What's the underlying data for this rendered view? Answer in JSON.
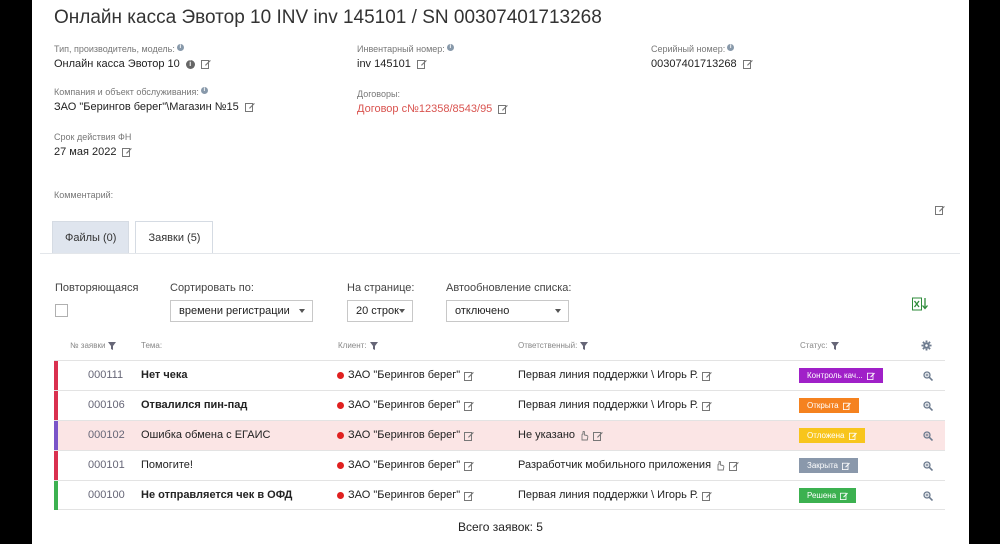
{
  "page": {
    "title": "Онлайн касса Эвотор 10 INV inv 145101 / SN 00307401713268"
  },
  "fields": {
    "type_label": "Тип, производитель, модель:",
    "type_value": "Онлайн касса Эвотор 10",
    "inventory_label": "Инвентарный номер:",
    "inventory_value": "inv 145101",
    "serial_label": "Серийный номер:",
    "serial_value": "00307401713268",
    "company_label": "Компания и объект обслуживания:",
    "company_value": "ЗАО \"Берингов берег\"\\Магазин №15",
    "contracts_label": "Договоры:",
    "contracts_value": "Договор с№12358/8543/95",
    "fn_label": "Срок действия ФН",
    "fn_value": "27 мая 2022",
    "comment_label": "Комментарий:"
  },
  "tabs": [
    {
      "label": "Файлы (0)"
    },
    {
      "label": "Заявки (5)"
    }
  ],
  "controls": {
    "recurring_label": "Повторяющаяся",
    "sort_label": "Сортировать по:",
    "sort_value": "времени регистрации",
    "per_page_label": "На странице:",
    "per_page_value": "20 строк",
    "autoupdate_label": "Автообновление списка:",
    "autoupdate_value": "отключено"
  },
  "table": {
    "headers": {
      "num": "№ заявки",
      "theme": "Тема:",
      "client": "Клиент:",
      "responsible": "Ответственный:",
      "status": "Статус:"
    },
    "rows": [
      {
        "num": "000111",
        "theme": "Нет чека",
        "client": "ЗАО \"Берингов берег\"",
        "responsible": "Первая линия поддержки \\ Игорь Р.",
        "status": "Контроль кач...",
        "status_color": "#a020c8",
        "bar_color": "#d9304f"
      },
      {
        "num": "000106",
        "theme": "Отвалился пин-пад",
        "client": "ЗАО \"Берингов берег\"",
        "responsible": "Первая линия поддержки \\ Игорь Р.",
        "status": "Открыта",
        "status_color": "#f5821f",
        "bar_color": "#d9304f"
      },
      {
        "num": "000102",
        "theme": "Ошибка обмена с ЕГАИС",
        "client": "ЗАО \"Берингов берег\"",
        "responsible": "Не указано",
        "status": "Отложена",
        "status_color": "#f8c51c",
        "bar_color": "#7a54c8"
      },
      {
        "num": "000101",
        "theme": "Помогите!",
        "client": "ЗАО \"Берингов берег\"",
        "responsible": "Разработчик мобильного приложения",
        "status": "Закрыта",
        "status_color": "#8a98ab",
        "bar_color": "#d9304f"
      },
      {
        "num": "000100",
        "theme": "Не отправляется чек в ОФД",
        "client": "ЗАО \"Берингов берег\"",
        "responsible": "Первая линия поддержки \\ Игорь Р.",
        "status": "Решена",
        "status_color": "#3cb150",
        "bar_color": "#3cb150"
      }
    ]
  },
  "footer": {
    "total": "Всего заявок: 5"
  }
}
